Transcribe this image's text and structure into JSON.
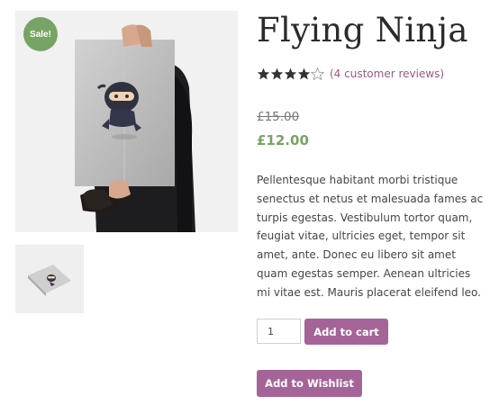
{
  "product": {
    "sale_badge": "Sale!",
    "title": "Flying Ninja",
    "rating": {
      "value": 4,
      "max": 5
    },
    "reviews_link": "(4 customer reviews)",
    "price_regular": "£15.00",
    "price_sale": "£12.00",
    "description": "Pellentesque habitant morbi tristique senectus et netus et malesuada fames ac turpis egestas. Vestibulum tortor quam, feugiat vitae, ultricies eget, tempor sit amet, ante. Donec eu libero sit amet quam egestas semper. Aenean ultricies mi vitae est. Mauris placerat eleifend leo.",
    "quantity": "1",
    "add_to_cart_label": "Add to cart",
    "wishlist_label": "Add to Wishlist"
  },
  "colors": {
    "accent": "#a46497",
    "sale_green": "#77a464",
    "link": "#96588a"
  },
  "icons": [
    "star-icon",
    "star-outline-icon"
  ]
}
